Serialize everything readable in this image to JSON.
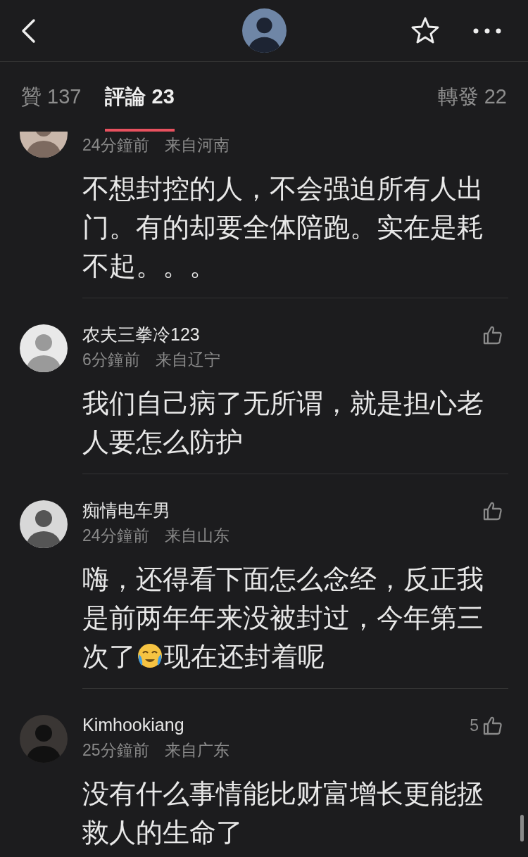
{
  "tabs": [
    {
      "label": "贊 137",
      "selected": false
    },
    {
      "label": "評論 23",
      "selected": true
    },
    {
      "label": "轉發 22",
      "selected": false
    }
  ],
  "comments": [
    {
      "time": "24分鐘前",
      "location": "来自河南",
      "content": [
        {
          "kind": "text",
          "text": "不想封控的人，不会强迫所有人出门。有的却要全体陪跑。实在是耗不起。。。"
        }
      ]
    },
    {
      "name": "农夫三拳冷123",
      "time": "6分鐘前",
      "location": "来自辽宁",
      "content": [
        {
          "kind": "text",
          "text": "我们自己病了无所谓，就是担心老人要怎么防护"
        }
      ]
    },
    {
      "name": "痴情电车男",
      "time": "24分鐘前",
      "location": "来自山东",
      "content": [
        {
          "kind": "text",
          "text": "嗨，还得看下面怎么念经，反正我是前两年年来没被封过，今年第三"
        },
        {
          "kind": "text",
          "text": "次了"
        },
        {
          "kind": "emoji"
        },
        {
          "kind": "text",
          "text": "现在还封着呢"
        }
      ]
    },
    {
      "name": "Kimhookiang",
      "time": "25分鐘前",
      "location": "来自广东",
      "likes": "5",
      "content": [
        {
          "kind": "text",
          "text": "没有什么事情能比财富增长更能拯救人的生命了"
        }
      ]
    }
  ]
}
